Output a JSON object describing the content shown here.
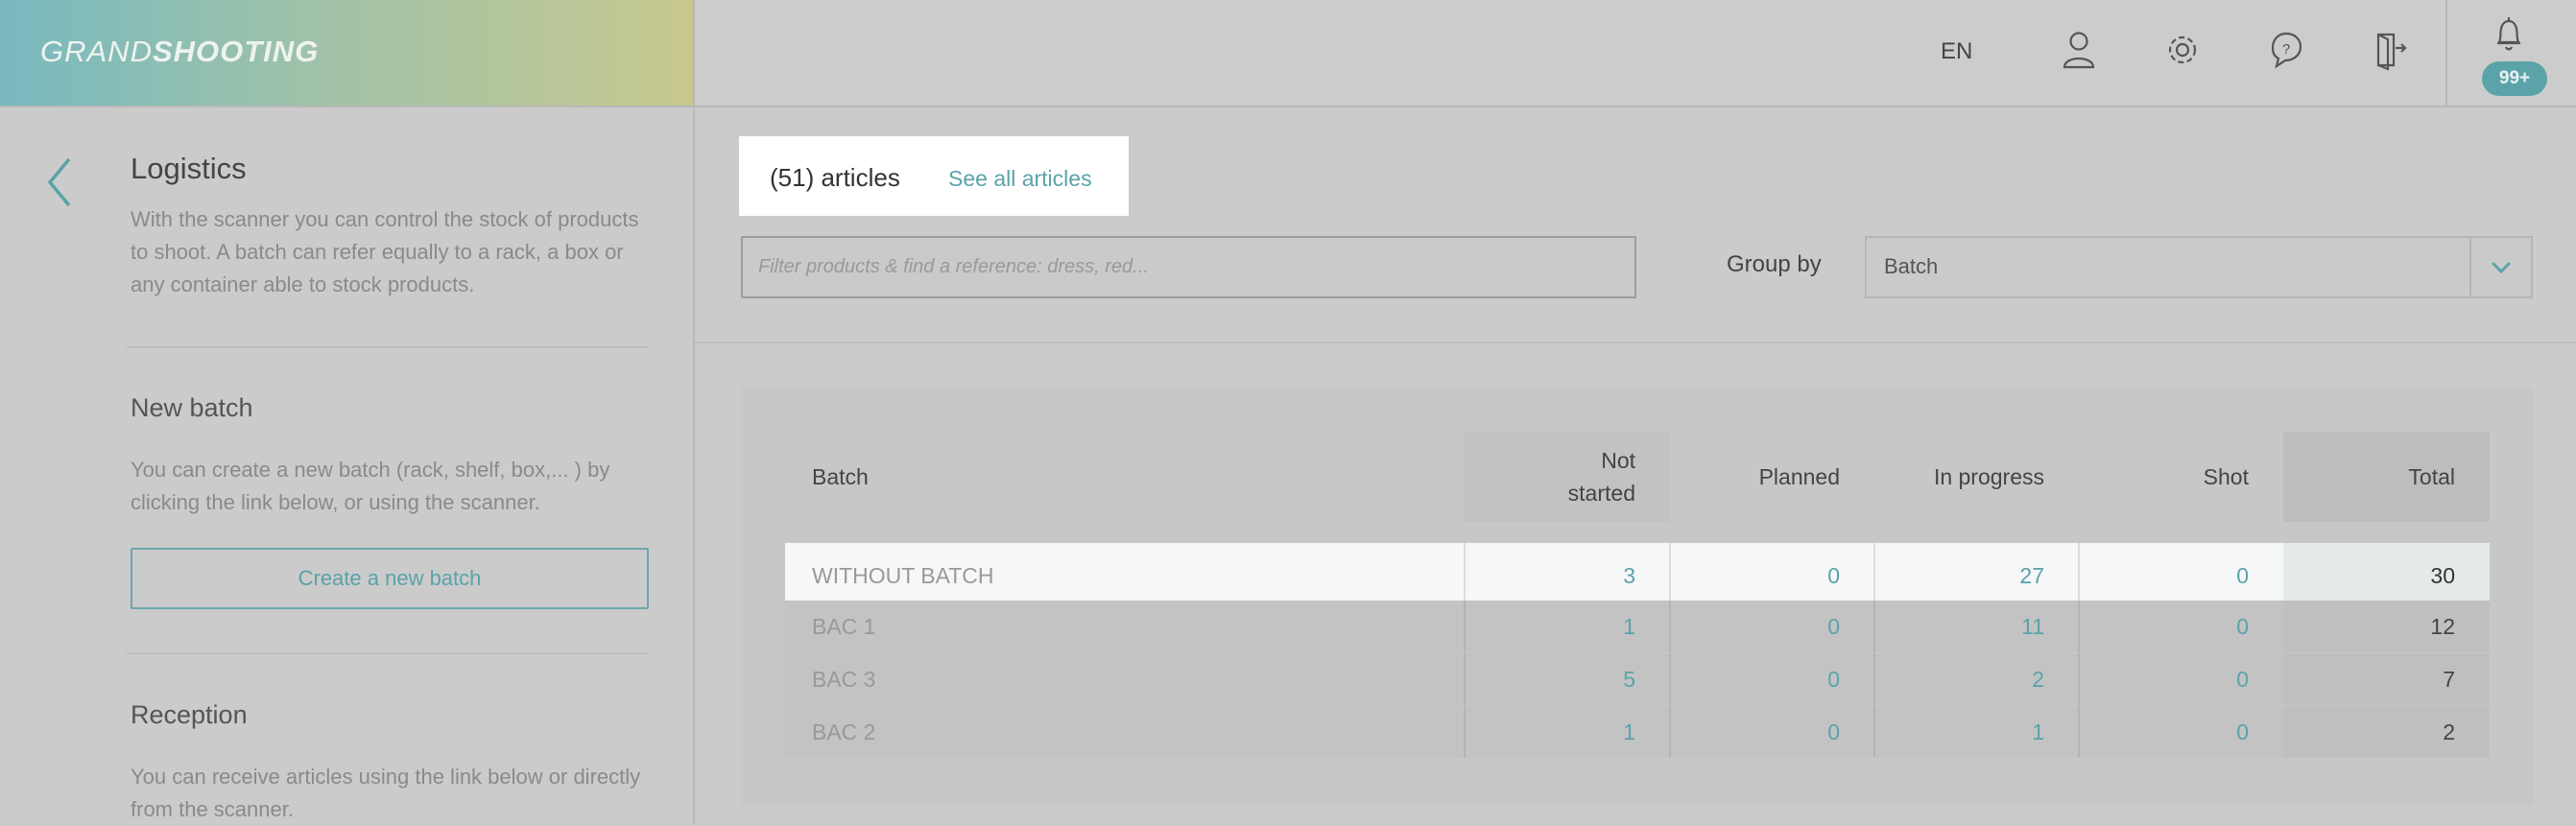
{
  "app": {
    "logo_light": "GRAND",
    "logo_bold": "SHOOTING"
  },
  "topbar": {
    "language": "EN",
    "icons": [
      "user-icon",
      "settings-icon",
      "help-icon",
      "logout-icon",
      "bell-icon"
    ],
    "notification_badge": "99+"
  },
  "sidebar": {
    "title": "Logistics",
    "intro": "With the scanner you can control the stock of products to shoot. A batch can refer equally to a rack, a box or any container able to stock products.",
    "new_batch": {
      "heading": "New batch",
      "text": "You can create a new batch (rack, shelf, box,... ) by clicking the link below, or using the scanner.",
      "button": "Create a new batch"
    },
    "reception": {
      "heading": "Reception",
      "text": "You can receive articles using the link below or directly from the scanner."
    }
  },
  "main": {
    "articles_count": "(51) articles",
    "see_all": "See all articles",
    "filter_placeholder": "Filter products & find a reference: dress, red...",
    "group_by_label": "Group by",
    "group_by_value": "Batch"
  },
  "table": {
    "headers": {
      "batch": "Batch",
      "not_started_1": "Not",
      "not_started_2": "started",
      "planned": "Planned",
      "in_progress": "In progress",
      "shot": "Shot",
      "total": "Total"
    },
    "rows": [
      {
        "batch": "WITHOUT BATCH",
        "not_started": "3",
        "planned": "0",
        "in_progress": "27",
        "shot": "0",
        "total": "30"
      },
      {
        "batch": "BAC 1",
        "not_started": "1",
        "planned": "0",
        "in_progress": "11",
        "shot": "0",
        "total": "12"
      },
      {
        "batch": "BAC 3",
        "not_started": "5",
        "planned": "0",
        "in_progress": "2",
        "shot": "0",
        "total": "7"
      },
      {
        "batch": "BAC 2",
        "not_started": "1",
        "planned": "0",
        "in_progress": "1",
        "shot": "0",
        "total": "2"
      }
    ]
  },
  "colors": {
    "accent": "#5aa3a8",
    "overlay": "#cbcbcb",
    "highlight": "#ffffff"
  }
}
